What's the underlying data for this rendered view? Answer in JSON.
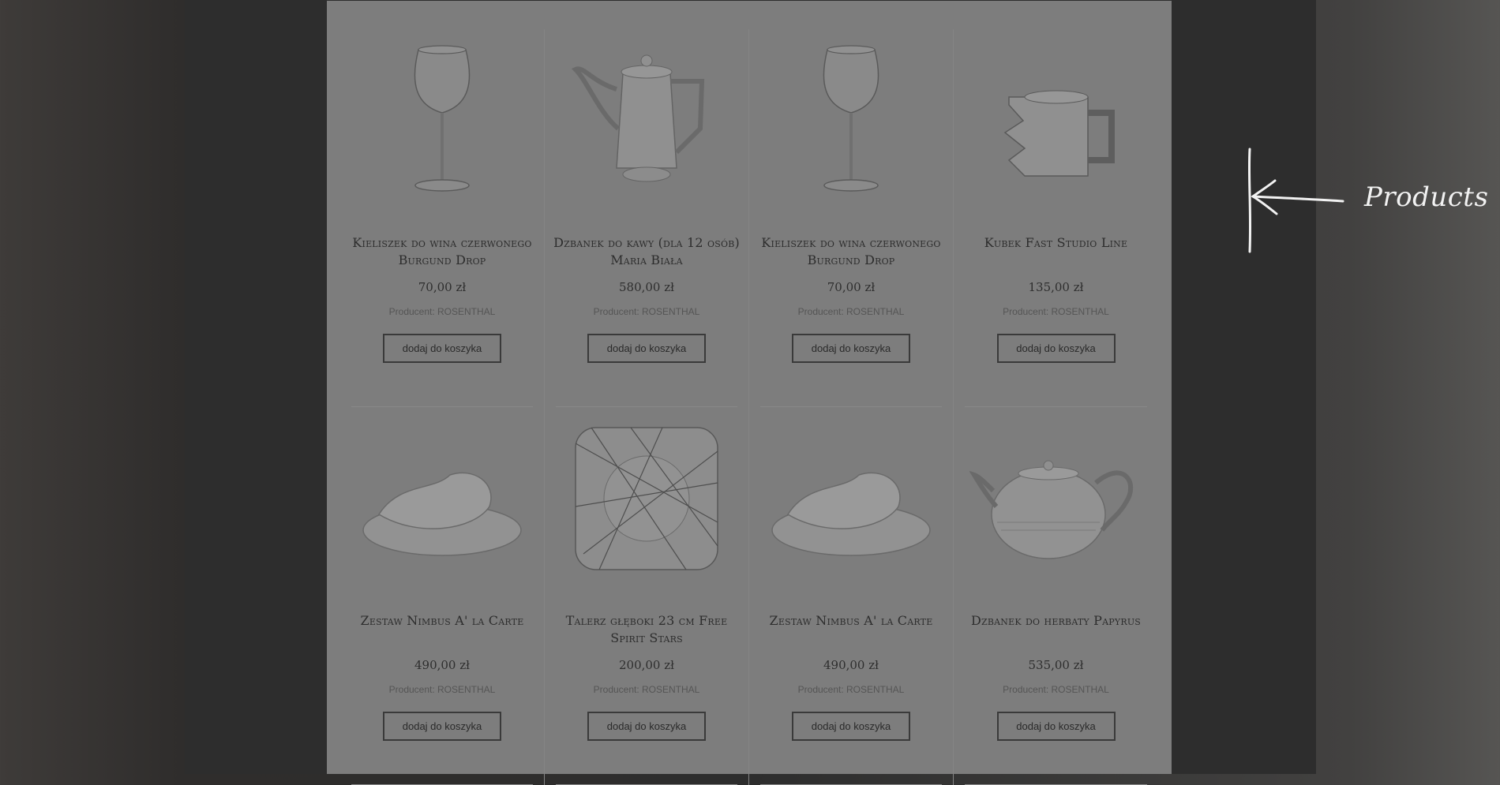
{
  "products": [
    {
      "name": "Kieliszek do wina czerwonego Burgund Drop",
      "price": "70,00 zł",
      "producer": "Producent: ROSENTHAL",
      "button": "dodaj do koszyka",
      "icon": "wine-glass-icon"
    },
    {
      "name": "Dzbanek do kawy (dla 12 osób) Maria Biała",
      "price": "580,00 zł",
      "producer": "Producent: ROSENTHAL",
      "button": "dodaj do koszyka",
      "icon": "coffee-pot-icon"
    },
    {
      "name": "Kieliszek do wina czerwonego Burgund Drop",
      "price": "70,00 zł",
      "producer": "Producent: ROSENTHAL",
      "button": "dodaj do koszyka",
      "icon": "wine-glass-icon"
    },
    {
      "name": "Kubek Fast Studio Line",
      "price": "135,00 zł",
      "producer": "Producent: ROSENTHAL",
      "button": "dodaj do koszyka",
      "icon": "mug-icon"
    },
    {
      "name": "Zestaw Nimbus A' la Carte",
      "price": "490,00 zł",
      "producer": "Producent: ROSENTHAL",
      "button": "dodaj do koszyka",
      "icon": "bowl-plate-icon"
    },
    {
      "name": "Talerz głęboki 23 cm Free Spirit Stars",
      "price": "200,00 zł",
      "producer": "Producent: ROSENTHAL",
      "button": "dodaj do koszyka",
      "icon": "square-plate-icon"
    },
    {
      "name": "Zestaw Nimbus A' la Carte",
      "price": "490,00 zł",
      "producer": "Producent: ROSENTHAL",
      "button": "dodaj do koszyka",
      "icon": "bowl-plate-icon"
    },
    {
      "name": "Dzbanek do herbaty Papyrus",
      "price": "535,00 zł",
      "producer": "Producent: ROSENTHAL",
      "button": "dodaj do koszyka",
      "icon": "teapot-icon"
    }
  ],
  "annotation": {
    "label": "Products",
    "icon": "arrow-left-icon"
  },
  "colors": {
    "overlay_panel": "#7d7d7d",
    "dark_background": "#2d2d2d",
    "annotation": "#f2f2f2"
  }
}
